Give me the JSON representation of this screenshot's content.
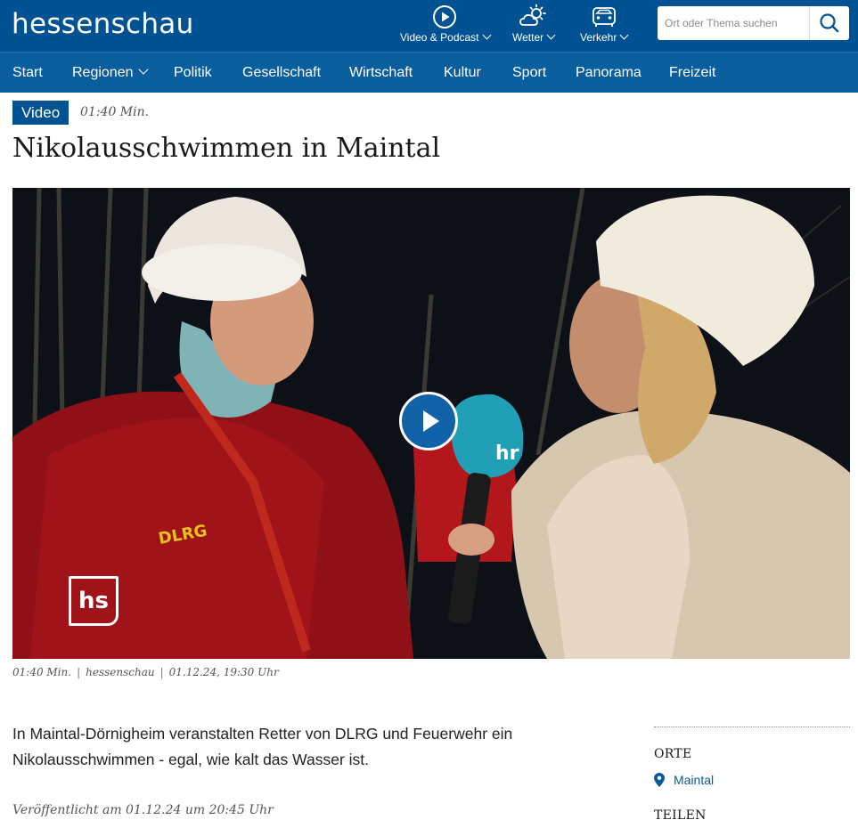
{
  "header": {
    "logo": "hessenschau",
    "nav": [
      {
        "label": "Video & Podcast",
        "icon": "play-circle-icon"
      },
      {
        "label": "Wetter",
        "icon": "weather-cloud-sun-icon"
      },
      {
        "label": "Verkehr",
        "icon": "traffic-car-icon"
      }
    ],
    "search": {
      "placeholder": "Ort oder Thema suchen",
      "icon": "search-icon"
    }
  },
  "mainnav": [
    "Start",
    "Regionen",
    "Politik",
    "Gesellschaft",
    "Wirtschaft",
    "Kultur",
    "Sport",
    "Panorama",
    "Freizeit"
  ],
  "article": {
    "badge": "Video",
    "duration": "01:40 Min.",
    "title": "Nikolausschwimmen in Maintal",
    "video": {
      "logo_text": "hs",
      "play_icon": "play-button-icon"
    },
    "meta": {
      "duration": "01:40 Min.",
      "source": "hessenschau",
      "date": "01.12.24, 19:30 Uhr"
    },
    "teaser": "In Maintal-Dörnigheim veranstalten Retter von DLRG und Feuerwehr ein Nikolausschwimmen - egal, wie kalt das Wasser ist.",
    "published": "Veröffentlicht am 01.12.24 um 20:45 Uhr"
  },
  "aside": {
    "orte_heading": "ORTE",
    "place": "Maintal",
    "teilen_heading": "TEILEN"
  },
  "colors": {
    "brand": "#005293",
    "nav": "#0a5e9e",
    "link": "#0b5a98"
  }
}
